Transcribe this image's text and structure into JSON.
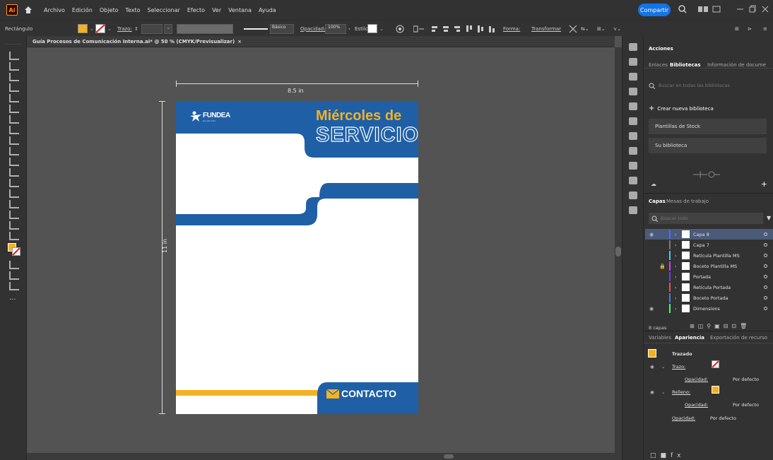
{
  "app": {
    "logo": "Ai",
    "menu": [
      "Archivo",
      "Edición",
      "Objeto",
      "Texto",
      "Seleccionar",
      "Efecto",
      "Ver",
      "Ventana",
      "Ayuda"
    ],
    "share_label": "Compartir"
  },
  "controlbar": {
    "selection_label": "Rectángulo",
    "stroke_label": "Trazo:",
    "stroke_value": "",
    "brush_label": "Básico",
    "opacity_label": "Opacidad:",
    "opacity_value": "100%",
    "style_label": "Estilo:",
    "shape_label": "Forma:",
    "transform_label": "Transformar"
  },
  "document": {
    "tab_title": "Guía Procesos de Comunicación Interna.ai* @ 50 % (CMYK/Previsualizar)",
    "width_label": "8.5 in",
    "height_label": "11 in"
  },
  "artwork": {
    "brand": "FUNDEA",
    "brand_tagline": "por ser mas",
    "heading_line1": "Miércoles de",
    "heading_line2": "SERVICIO",
    "contact_label": "CONTACTO",
    "colors": {
      "blue": "#1f5fa6",
      "yellow": "#f2b224",
      "heading": "#f2b224"
    }
  },
  "libraries_panel": {
    "title": "Acciones",
    "tabs": [
      "Enlaces",
      "Bibliotecas",
      "Información de docume"
    ],
    "active_tab": "Bibliotecas",
    "search_placeholder": "Buscar en todas las bibliotecas",
    "create_label": "Crear nueva biblioteca",
    "items": [
      "Plantillas de Stock",
      "Su biblioteca"
    ]
  },
  "layers_panel": {
    "tabs": [
      "Capas",
      "Mesas de trabajo"
    ],
    "search_placeholder": "Buscar todo",
    "layers": [
      {
        "name": "Capa 8",
        "color": "#4d6bff",
        "visible": true,
        "locked": false,
        "selected": true
      },
      {
        "name": "Capa 7",
        "color": "#7a7a7a",
        "visible": false,
        "locked": false,
        "selected": false
      },
      {
        "name": "Retícula Plantilla MS",
        "color": "#35d2ff",
        "visible": false,
        "locked": false,
        "selected": false
      },
      {
        "name": "Boceto Plantilla MS",
        "color": "#d43fff",
        "visible": false,
        "locked": true,
        "selected": false
      },
      {
        "name": "Portada",
        "color": "#6b3dff",
        "visible": false,
        "locked": false,
        "selected": false
      },
      {
        "name": "Retícula Portada",
        "color": "#ff4b3e",
        "visible": false,
        "locked": false,
        "selected": false
      },
      {
        "name": "Boceto Portada",
        "color": "#3d7bff",
        "visible": false,
        "locked": false,
        "selected": false
      },
      {
        "name": "Dimensions",
        "color": "#3dff6b",
        "visible": true,
        "locked": false,
        "selected": false
      }
    ],
    "count_label": "8 capas"
  },
  "appearance_panel": {
    "tabs": [
      "Variables",
      "Apariencia",
      "Exportación de recurso"
    ],
    "active_tab": "Apariencia",
    "object_label": "Trazado",
    "stroke_label": "Trazo:",
    "opacity_label": "Opacidad:",
    "opacity_value": "Por defecto",
    "fill_label": "Relleno:"
  }
}
